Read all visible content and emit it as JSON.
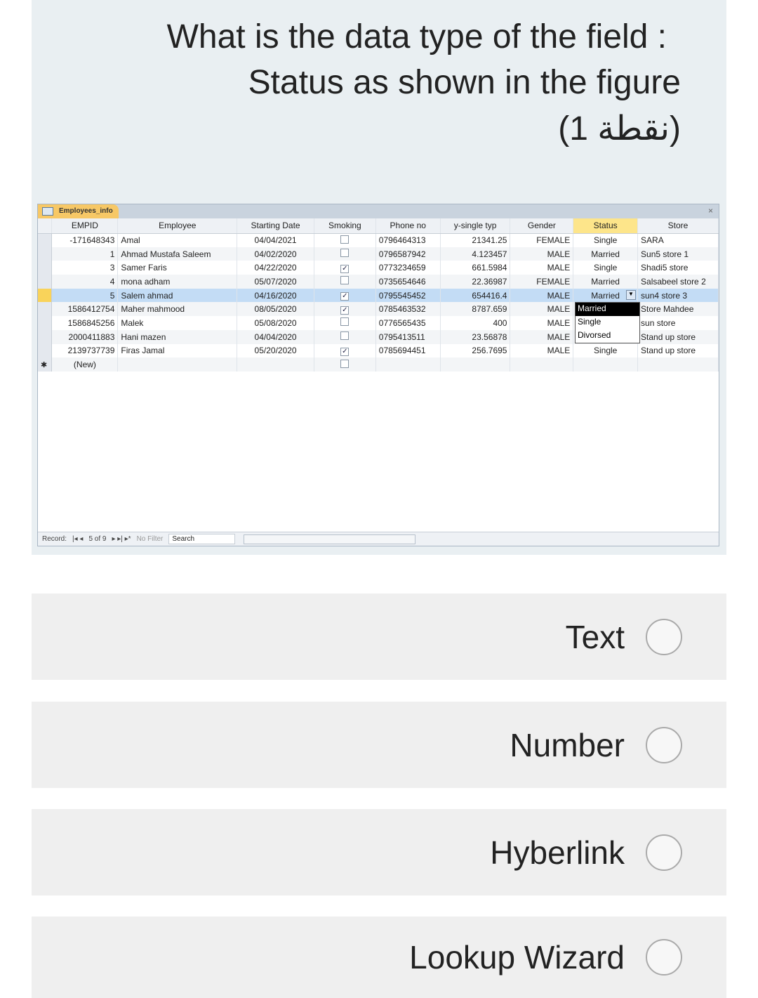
{
  "question": {
    "line1": "What is the data type of the field :",
    "line2": "Status as shown in the figure",
    "line3": "(1 نقطة)"
  },
  "window": {
    "tab": "Employees_info",
    "close": "×"
  },
  "columns": [
    "EMPID",
    "Employee",
    "Starting Date",
    "Smoking",
    "Phone no",
    "y-single typ",
    "Gender",
    "Status",
    "Store"
  ],
  "rows": [
    [
      "-171648343",
      "Amal",
      "04/04/2021",
      false,
      "0796464313",
      "21341.25",
      "FEMALE",
      "Single",
      "SARA"
    ],
    [
      "1",
      "Ahmad Mustafa Saleem",
      "04/02/2020",
      false,
      "0796587942",
      "4.123457",
      "MALE",
      "Married",
      "Sun5 store 1"
    ],
    [
      "3",
      "Samer Faris",
      "04/22/2020",
      true,
      "0773234659",
      "661.5984",
      "MALE",
      "Single",
      "Shadi5 store"
    ],
    [
      "4",
      "mona adham",
      "05/07/2020",
      false,
      "0735654646",
      "22.36987",
      "FEMALE",
      "Married",
      "Salsabeel store 2"
    ],
    [
      "5",
      "Salem ahmad",
      "04/16/2020",
      true,
      "0795545452",
      "654416.4",
      "MALE",
      "Married",
      "sun4 store 3"
    ],
    [
      "1586412754",
      "Maher mahmood",
      "08/05/2020",
      true,
      "0785463532",
      "8787.659",
      "MALE",
      "",
      "Store Mahdee"
    ],
    [
      "1586845256",
      "Malek",
      "05/08/2020",
      false,
      "0776565435",
      "400",
      "MALE",
      "",
      "sun store"
    ],
    [
      "2000411883",
      "Hani mazen",
      "04/04/2020",
      false,
      "0795413511",
      "23.56878",
      "MALE",
      "",
      "Stand up store"
    ],
    [
      "2139737739",
      "Firas Jamal",
      "05/20/2020",
      true,
      "0785694451",
      "256.7695",
      "MALE",
      "Single",
      "Stand up store"
    ]
  ],
  "new_row": "(New)",
  "dropdown": {
    "options": [
      "Married",
      "Single",
      "Divorsed"
    ],
    "highlighted": "Married"
  },
  "status_bar": {
    "record_label": "Record:",
    "record": "5 of 9",
    "filter": "No Filter",
    "search": "Search"
  },
  "options": [
    {
      "label": "Text"
    },
    {
      "label": "Number"
    },
    {
      "label": "Hyberlink"
    },
    {
      "label": "Lookup Wizard"
    }
  ],
  "colors": {
    "tab": "#f7c866",
    "selected_row": "#c3dcf5",
    "status_header": "#fde58a"
  }
}
